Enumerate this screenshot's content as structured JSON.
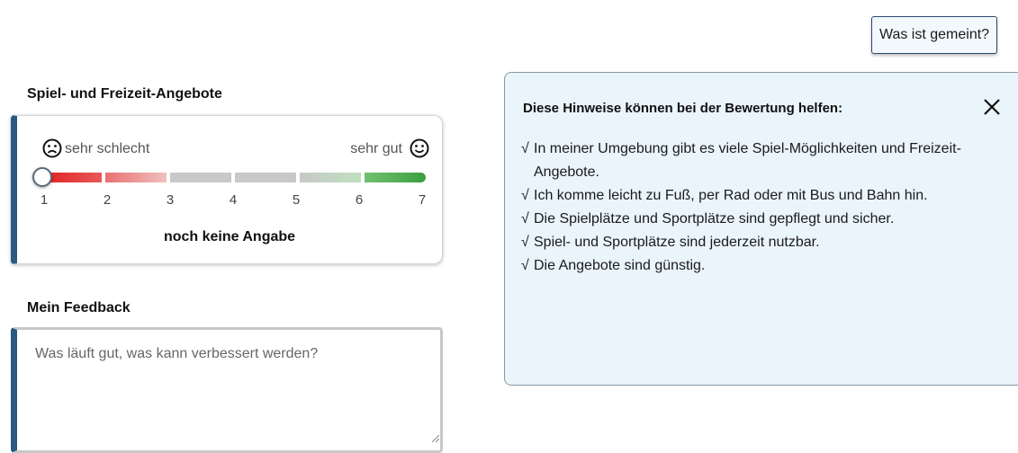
{
  "help_button": {
    "label": "Was ist gemeint?"
  },
  "rating": {
    "title": "Spiel- und Freizeit-Angebote",
    "label_low": "sehr schlecht",
    "label_high": "sehr gut",
    "scale": [
      "1",
      "2",
      "3",
      "4",
      "5",
      "6",
      "7"
    ],
    "status": "noch keine Angabe",
    "selected_value": null
  },
  "feedback": {
    "title": "Mein Feedback",
    "placeholder": "Was läuft gut, was kann verbessert werden?",
    "value": ""
  },
  "hints": {
    "title": "Diese Hinweise können bei der Bewertung helfen:",
    "check_glyph": "√",
    "items": [
      "In meiner Umgebung gibt es viele Spiel-Möglichkeiten und Freizeit-Angebote.",
      "Ich komme leicht zu Fuß, per Rad oder mit Bus und Bahn hin.",
      "Die Spielplätze und Sportplätze sind gepflegt und sicher.",
      "Spiel- und Sportplätze sind jederzeit nutzbar.",
      "Die Angebote sind günstig."
    ]
  },
  "colors": {
    "accent_bar": "#2a5a82",
    "panel_bg": "#e9f4fb",
    "scale_red": "#e02020",
    "scale_grey": "#c8c8c8",
    "scale_green": "#3aa040"
  }
}
